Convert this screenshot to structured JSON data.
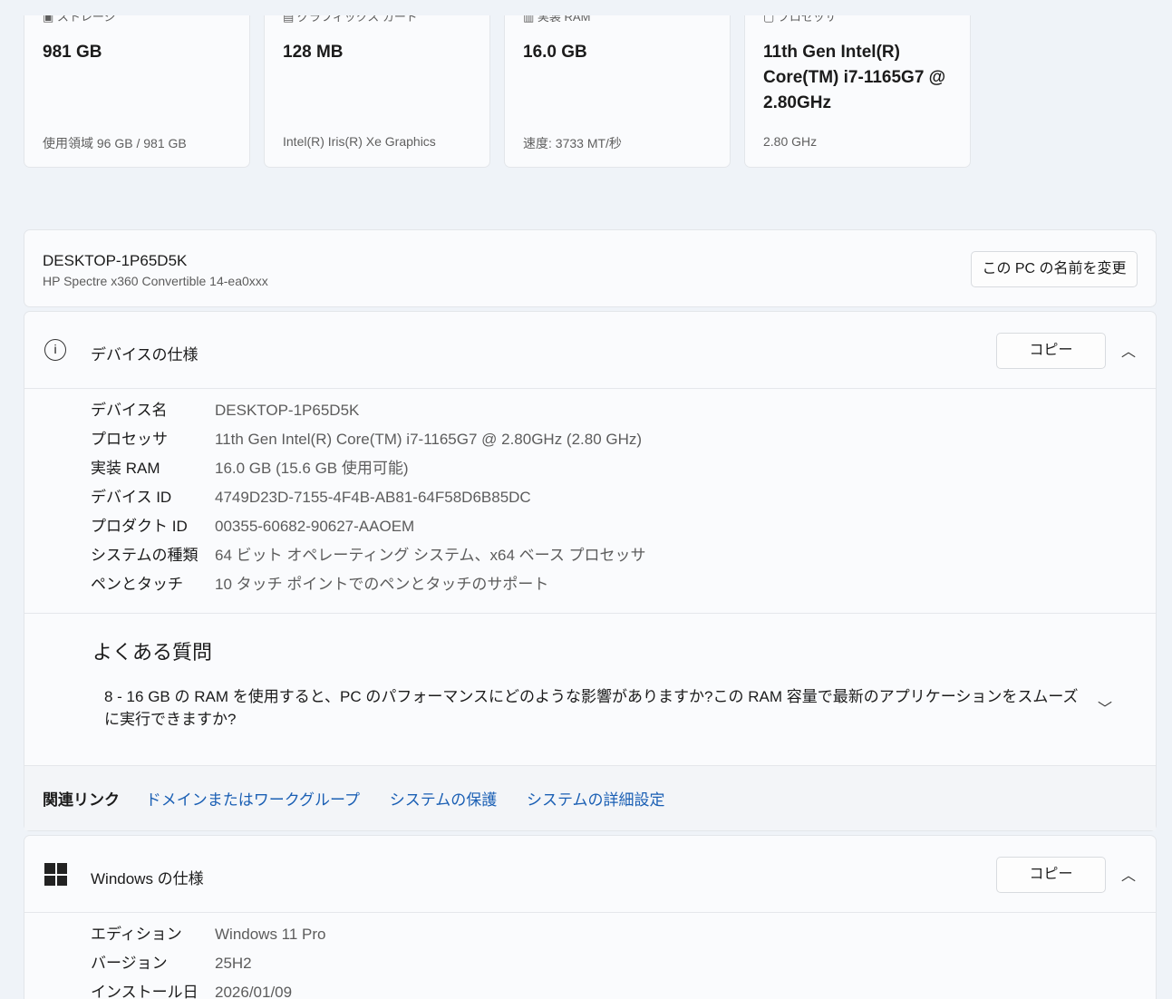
{
  "tiles": [
    {
      "icon": "storage-icon",
      "label": "ストレージ",
      "value": "981 GB",
      "sub": "使用領域 96 GB / 981 GB"
    },
    {
      "icon": "graphics-card-icon",
      "label": "グラフィックス カード",
      "value": "128 MB",
      "sub": "Intel(R) Iris(R) Xe Graphics"
    },
    {
      "icon": "ram-icon",
      "label": "実装 RAM",
      "value": "16.0 GB",
      "sub": "速度: 3733 MT/秒"
    },
    {
      "icon": "processor-icon",
      "label": "プロセッサ",
      "value": "11th Gen Intel(R) Core(TM) i7-1165G7 @ 2.80GHz",
      "sub": "2.80 GHz"
    }
  ],
  "pc": {
    "name": "DESKTOP-1P65D5K",
    "model": "HP Spectre x360 Convertible 14-ea0xxx",
    "rename": "この PC の名前を変更"
  },
  "device_spec": {
    "title": "デバイスの仕様",
    "copy": "コピー",
    "rows": [
      {
        "k": "デバイス名",
        "v": "DESKTOP-1P65D5K"
      },
      {
        "k": "プロセッサ",
        "v": "11th Gen Intel(R) Core(TM) i7-1165G7 @ 2.80GHz (2.80 GHz)"
      },
      {
        "k": "実装 RAM",
        "v": "16.0 GB (15.6 GB 使用可能)"
      },
      {
        "k": "デバイス ID",
        "v": "4749D23D-7155-4F4B-AB81-64F58D6B85DC"
      },
      {
        "k": "プロダクト ID",
        "v": "00355-60682-90627-AAOEM"
      },
      {
        "k": "システムの種類",
        "v": "64 ビット オペレーティング システム、x64 ベース プロセッサ"
      },
      {
        "k": "ペンとタッチ",
        "v": "10 タッチ ポイントでのペンとタッチのサポート"
      }
    ]
  },
  "faq": {
    "title": "よくある質問",
    "question": "8 - 16 GB の RAM を使用すると、PC のパフォーマンスにどのような影響がありますか?この RAM 容量で最新のアプリケーションをスムーズに実行できますか?"
  },
  "related": {
    "label": "関連リンク",
    "links": [
      "ドメインまたはワークグループ",
      "システムの保護",
      "システムの詳細設定"
    ]
  },
  "windows_spec": {
    "title": "Windows の仕様",
    "copy": "コピー",
    "rows": [
      {
        "k": "エディション",
        "v": "Windows 11 Pro"
      },
      {
        "k": "バージョン",
        "v": "25H2"
      },
      {
        "k": "インストール日",
        "v": "2026/01/09"
      }
    ]
  }
}
